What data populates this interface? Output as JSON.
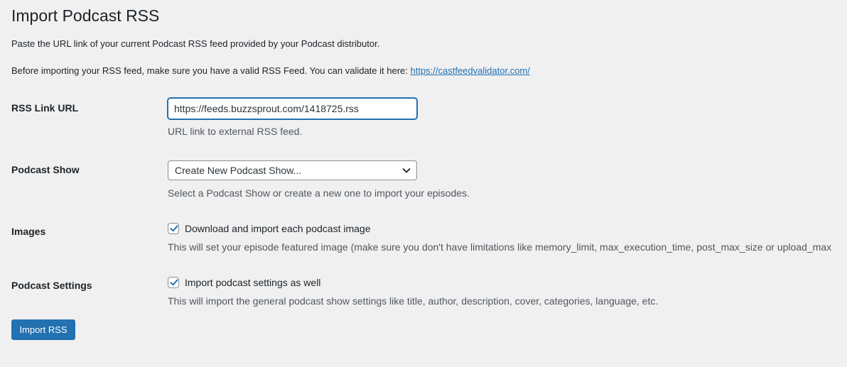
{
  "page": {
    "title": "Import Podcast RSS",
    "intro_1": "Paste the URL link of your current Podcast RSS feed provided by your Podcast distributor.",
    "intro_2_prefix": "Before importing your RSS feed, make sure you have a valid RSS Feed. You can validate it here: ",
    "intro_2_link": "https://castfeedvalidator.com/"
  },
  "form": {
    "rss": {
      "label": "RSS Link URL",
      "value": "https://feeds.buzzsprout.com/1418725.rss",
      "description": "URL link to external RSS feed."
    },
    "show": {
      "label": "Podcast Show",
      "selected": "Create New Podcast Show...",
      "description": "Select a Podcast Show or create a new one to import your episodes."
    },
    "images": {
      "label": "Images",
      "checkbox_label": "Download and import each podcast image",
      "checked": true,
      "description": "This will set your episode featured image (make sure you don't have limitations like memory_limit, max_execution_time, post_max_size or upload_max"
    },
    "settings": {
      "label": "Podcast Settings",
      "checkbox_label": "Import podcast settings as well",
      "checked": true,
      "description": "This will import the general podcast show settings like title, author, description, cover, categories, language, etc."
    },
    "submit_label": "Import RSS"
  },
  "colors": {
    "background": "#f0f0f1",
    "accent": "#2271b1",
    "text": "#1d2327",
    "muted_text": "#50575e"
  },
  "icons": {
    "select_caret": "chevron-down-icon",
    "checkbox_mark": "checkmark-icon"
  }
}
